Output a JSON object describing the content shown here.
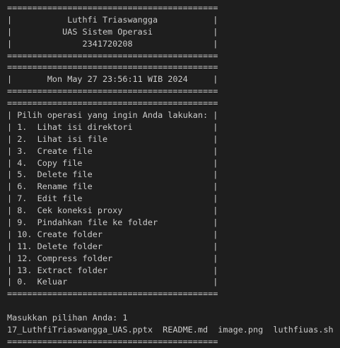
{
  "terminal": {
    "lines": [
      "==========================================",
      "|           Luthfi Triaswangga           |",
      "|          UAS Sistem Operasi            |",
      "|              2341720208                |",
      "==========================================",
      "==========================================",
      "|       Mon May 27 23:56:11 WIB 2024     |",
      "==========================================",
      "==========================================",
      "| Pilih operasi yang ingin Anda lakukan: |",
      "| 1.  Lihat isi direktori                |",
      "| 2.  Lihat isi file                     |",
      "| 3.  Create file                        |",
      "| 4.  Copy file                          |",
      "| 5.  Delete file                        |",
      "| 6.  Rename file                        |",
      "| 7.  Edit file                          |",
      "| 8.  Cek koneksi proxy                  |",
      "| 9.  Pindahkan file ke folder           |",
      "| 10. Create folder                      |",
      "| 11. Delete folder                      |",
      "| 12. Compress folder                    |",
      "| 13. Extract folder                     |",
      "| 0.  Keluar                             |",
      "==========================================",
      "",
      "Masukkan pilihan Anda: 1",
      "17_LuthfiTriaswangga_UAS.pptx  README.md  image.png  luthfiuas.sh",
      "=========================================="
    ]
  }
}
